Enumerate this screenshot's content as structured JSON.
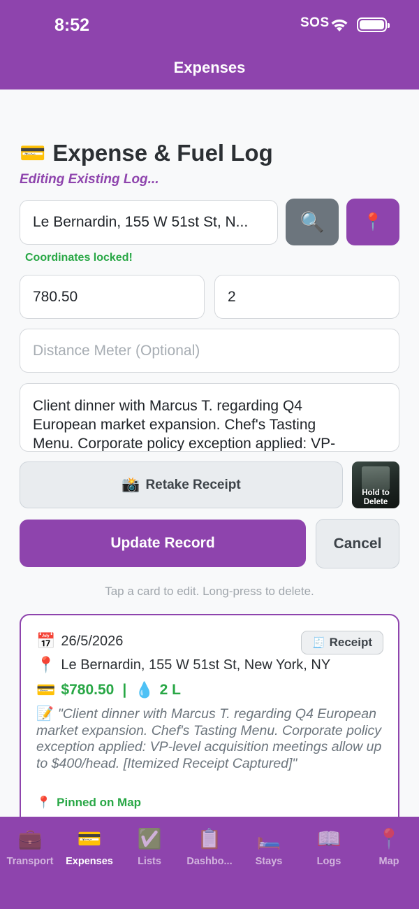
{
  "status": {
    "time": "8:52",
    "sos": "SOS"
  },
  "nav": {
    "title": "Expenses"
  },
  "form": {
    "title_icon": "💳",
    "title": "Expense & Fuel Log",
    "editing": "Editing Existing Log...",
    "location_value": "Le Bernardin, 155 W 51st St, N...",
    "search_icon": "🔍",
    "pin_icon": "📍",
    "coords_status": "Coordinates locked!",
    "amount_value": "780.50",
    "volume_value": "2",
    "distance_placeholder": "Distance Meter (Optional)",
    "notes_lines": [
      "Client dinner with Marcus T. regarding Q4",
      "European market expansion. Chef's Tasting",
      "Menu. Corporate policy exception applied: VP-"
    ],
    "retake_icon": "📸",
    "retake_label": "Retake Receipt",
    "thumb_label": "Hold to Delete",
    "update_label": "Update Record",
    "cancel_label": "Cancel",
    "hint": "Tap a card to edit. Long-press to delete."
  },
  "card": {
    "date_icon": "📅",
    "date": "26/5/2026",
    "place_icon": "📍",
    "place": "Le Bernardin, 155 W 51st St, New York, NY",
    "money_icon": "💳",
    "amount": "$780.50",
    "separator": "|",
    "fuel_icon": "💧",
    "volume": "2 L",
    "receipt_icon": "🧾",
    "receipt_label": "Receipt",
    "note_icon": "📝",
    "note": "\"Client dinner with Marcus T. regarding Q4 European market expansion. Chef's Tasting Menu. Corporate policy exception applied: VP-level acquisition meetings allow up to $400/head. [Itemized Receipt Captured]\"",
    "pinned_icon": "📍",
    "pinned": "Pinned on Map"
  },
  "tabs": [
    {
      "icon": "💼",
      "label": "Transport"
    },
    {
      "icon": "💳",
      "label": "Expenses"
    },
    {
      "icon": "✅",
      "label": "Lists"
    },
    {
      "icon": "📋",
      "label": "Dashbo..."
    },
    {
      "icon": "🛏️",
      "label": "Stays"
    },
    {
      "icon": "📖",
      "label": "Logs"
    },
    {
      "icon": "📍",
      "label": "Map"
    }
  ],
  "colors": {
    "accent": "#8e44ad",
    "success": "#28a745",
    "secondary": "#6c757d"
  }
}
